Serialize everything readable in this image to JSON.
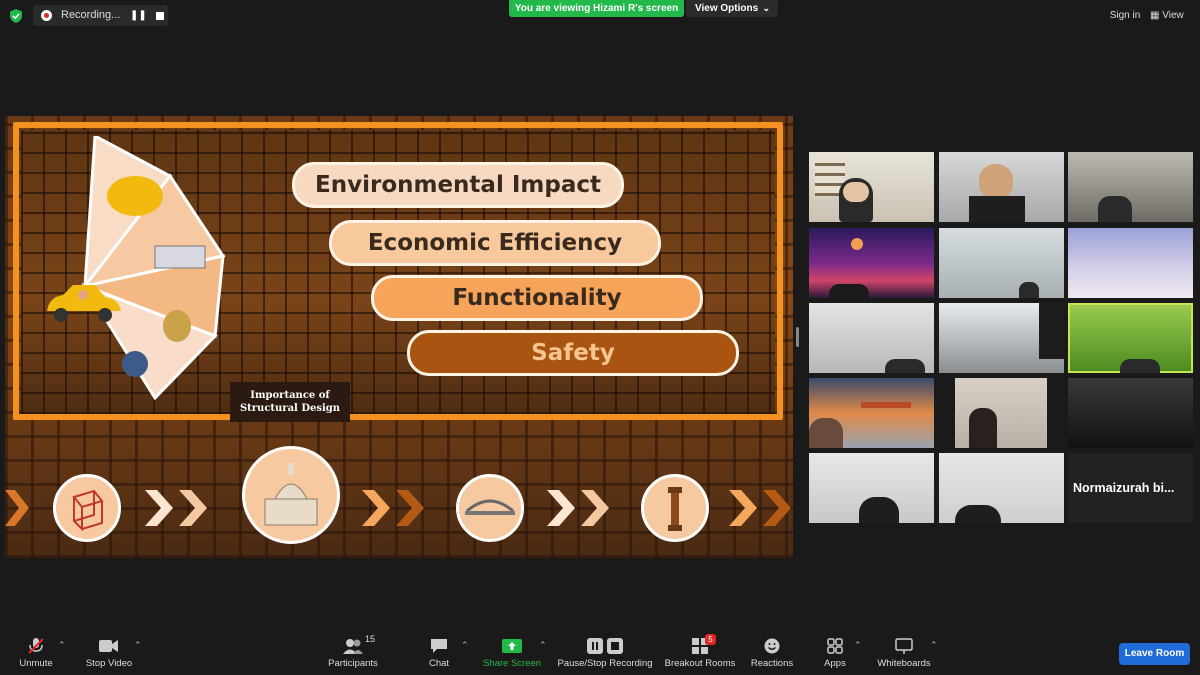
{
  "top_bar": {
    "recording_label": "Recording...",
    "viewing_banner": "You are viewing Hizami R's screen",
    "view_options_label": "View Options",
    "sign_in_label": "Sign in",
    "view_label": "View"
  },
  "slide": {
    "pills": [
      "Environmental Impact",
      "Economic Efficiency",
      "Functionality",
      "Safety"
    ],
    "importance_title": "Importance of Structural Design"
  },
  "gallery": {
    "name_tile_label": "Normaizurah bi..."
  },
  "toolbar": {
    "unmute": "Unmute",
    "stop_video": "Stop Video",
    "participants": "Participants",
    "participants_count": "15",
    "chat": "Chat",
    "share_screen": "Share Screen",
    "pause_stop_recording": "Pause/Stop Recording",
    "breakout_rooms": "Breakout Rooms",
    "breakout_badge": "5",
    "reactions": "Reactions",
    "apps": "Apps",
    "whiteboards": "Whiteboards",
    "leave_room": "Leave Room"
  },
  "colors": {
    "share_green": "#23b84a",
    "leave_blue": "#1f6bd8",
    "slide_orange": "#f39220"
  }
}
